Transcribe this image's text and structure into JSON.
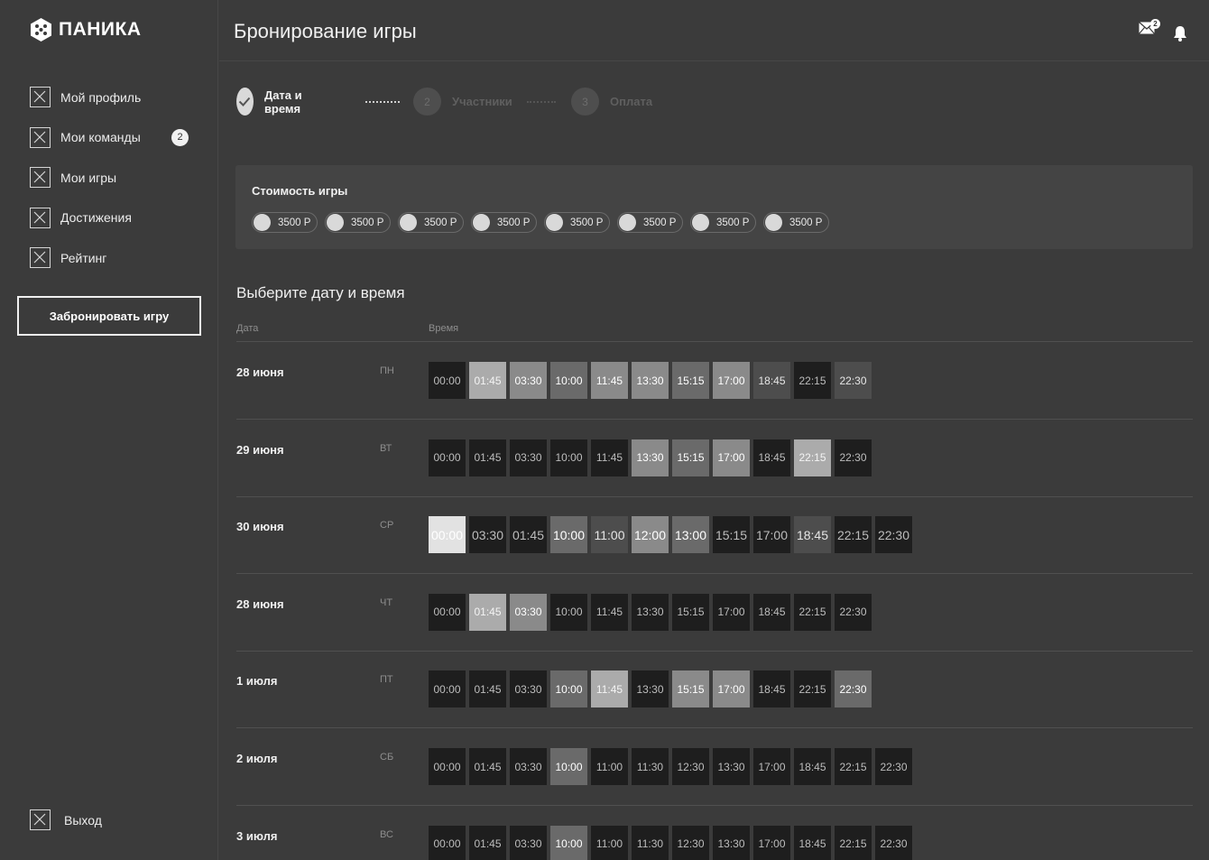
{
  "brand": {
    "name": "ПАНИКА"
  },
  "sidebar": {
    "items": [
      {
        "label": "Мой профиль",
        "icon": "x-box-icon"
      },
      {
        "label": "Мои команды",
        "icon": "x-box-icon",
        "badge": "2"
      },
      {
        "label": "Мои игры",
        "icon": "x-box-icon"
      },
      {
        "label": "Достижения",
        "icon": "x-box-icon"
      },
      {
        "label": "Рейтинг",
        "icon": "x-box-icon"
      }
    ],
    "book_button": "Забронировать игру",
    "logout": "Выход"
  },
  "header": {
    "title": "Бронирование игры",
    "mail_badge": "2"
  },
  "stepper": {
    "steps": [
      {
        "number": "",
        "label": "Дата и время",
        "state": "done"
      },
      {
        "number": "2",
        "label": "Участники",
        "state": "pending"
      },
      {
        "number": "3",
        "label": "Оплата",
        "state": "pending"
      }
    ]
  },
  "cost": {
    "title": "Стоимость игры",
    "prices": [
      "3500 Р",
      "3500 Р",
      "3500 Р",
      "3500 Р",
      "3500 Р",
      "3500 Р",
      "3500 Р",
      "3500 Р"
    ]
  },
  "schedule": {
    "title": "Выберите дату и время",
    "col_date": "Дата",
    "col_time": "Время",
    "rows": [
      {
        "date": "28 июня",
        "dow": "ПН",
        "slots": [
          [
            "00:00",
            0
          ],
          [
            "01:45",
            3
          ],
          [
            "03:30",
            2
          ],
          [
            "10:00",
            1
          ],
          [
            "11:45",
            2
          ],
          [
            "13:30",
            2
          ],
          [
            "15:15",
            1
          ],
          [
            "17:00",
            2
          ],
          [
            "18:45",
            5
          ],
          [
            "22:15",
            0
          ],
          [
            "22:30",
            5
          ]
        ]
      },
      {
        "date": "29 июня",
        "dow": "ВТ",
        "slots": [
          [
            "00:00",
            0
          ],
          [
            "01:45",
            0
          ],
          [
            "03:30",
            0
          ],
          [
            "10:00",
            0
          ],
          [
            "11:45",
            0
          ],
          [
            "13:30",
            2
          ],
          [
            "15:15",
            1
          ],
          [
            "17:00",
            2
          ],
          [
            "18:45",
            0
          ],
          [
            "22:15",
            3
          ],
          [
            "22:30",
            0
          ]
        ]
      },
      {
        "date": "30 июня",
        "dow": "СР",
        "big": true,
        "slots": [
          [
            "00:00",
            4
          ],
          [
            "03:30",
            0
          ],
          [
            "01:45",
            0
          ],
          [
            "10:00",
            1
          ],
          [
            "11:00",
            5
          ],
          [
            "12:00",
            2
          ],
          [
            "13:00",
            1
          ],
          [
            "15:15",
            0
          ],
          [
            "17:00",
            0
          ],
          [
            "18:45",
            5
          ],
          [
            "22:15",
            0
          ],
          [
            "22:30",
            0
          ]
        ]
      },
      {
        "date": "28 июня",
        "dow": "ЧТ",
        "slots": [
          [
            "00:00",
            0
          ],
          [
            "01:45",
            3
          ],
          [
            "03:30",
            2
          ],
          [
            "10:00",
            0
          ],
          [
            "11:45",
            0
          ],
          [
            "13:30",
            0
          ],
          [
            "15:15",
            0
          ],
          [
            "17:00",
            0
          ],
          [
            "18:45",
            0
          ],
          [
            "22:15",
            0
          ],
          [
            "22:30",
            0
          ]
        ]
      },
      {
        "date": "1 июля",
        "dow": "ПТ",
        "slots": [
          [
            "00:00",
            0
          ],
          [
            "01:45",
            0
          ],
          [
            "03:30",
            0
          ],
          [
            "10:00",
            1
          ],
          [
            "11:45",
            3
          ],
          [
            "13:30",
            0
          ],
          [
            "15:15",
            2
          ],
          [
            "17:00",
            2
          ],
          [
            "18:45",
            0
          ],
          [
            "22:15",
            0
          ],
          [
            "22:30",
            1
          ]
        ]
      },
      {
        "date": "2 июля",
        "dow": "СБ",
        "slots": [
          [
            "00:00",
            0
          ],
          [
            "01:45",
            0
          ],
          [
            "03:30",
            0
          ],
          [
            "10:00",
            1
          ],
          [
            "11:00",
            0
          ],
          [
            "11:30",
            0
          ],
          [
            "12:30",
            0
          ],
          [
            "13:30",
            0
          ],
          [
            "17:00",
            0
          ],
          [
            "18:45",
            0
          ],
          [
            "22:15",
            0
          ],
          [
            "22:30",
            0
          ]
        ]
      },
      {
        "date": "3 июля",
        "dow": "ВС",
        "slots": [
          [
            "00:00",
            0
          ],
          [
            "01:45",
            0
          ],
          [
            "03:30",
            0
          ],
          [
            "10:00",
            1
          ],
          [
            "11:00",
            0
          ],
          [
            "11:30",
            0
          ],
          [
            "12:30",
            0
          ],
          [
            "13:30",
            0
          ],
          [
            "17:00",
            0
          ],
          [
            "18:45",
            0
          ],
          [
            "22:15",
            0
          ],
          [
            "22:30",
            0
          ]
        ]
      }
    ]
  }
}
